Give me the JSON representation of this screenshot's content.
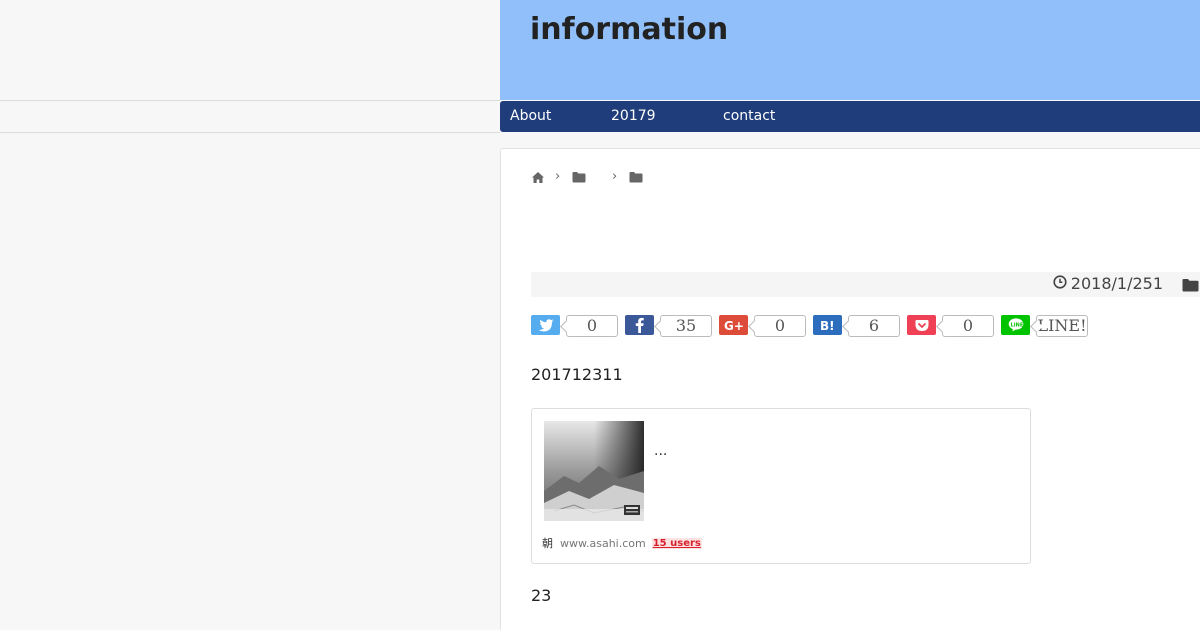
{
  "site": {
    "title": "information"
  },
  "nav": {
    "items": [
      {
        "label": "About"
      },
      {
        "label": "20179"
      },
      {
        "label": "contact"
      }
    ]
  },
  "breadcrumb": {
    "icons": [
      "home-icon",
      "folder-icon",
      "folder-icon"
    ],
    "separator": "›"
  },
  "post": {
    "date": "2018/1/251",
    "paragraph_1": "201712311",
    "paragraph_2": "23"
  },
  "share": {
    "items": [
      {
        "service": "twitter",
        "icon": "twitter-icon",
        "color": "#55acee",
        "count": "0"
      },
      {
        "service": "facebook",
        "icon": "facebook-icon",
        "color": "#3b5998",
        "count": "35"
      },
      {
        "service": "google-plus",
        "icon": "google-plus-icon",
        "color": "#dd4b39",
        "count": "0"
      },
      {
        "service": "hatena",
        "icon": "hatena-bookmark-icon",
        "color": "#2c6ebd",
        "count": "6"
      },
      {
        "service": "pocket",
        "icon": "pocket-icon",
        "color": "#ef4056",
        "count": "0"
      },
      {
        "service": "line",
        "icon": "line-icon",
        "color": "#00c300",
        "count": "LINE!"
      }
    ]
  },
  "embed_card": {
    "excerpt": "...",
    "favicon": "朝",
    "domain": "www.asahi.com",
    "users": "15 users"
  },
  "colors": {
    "header_bg": "#90bff9",
    "nav_bg": "#1f3d7a",
    "page_bg": "#f7f7f7"
  }
}
